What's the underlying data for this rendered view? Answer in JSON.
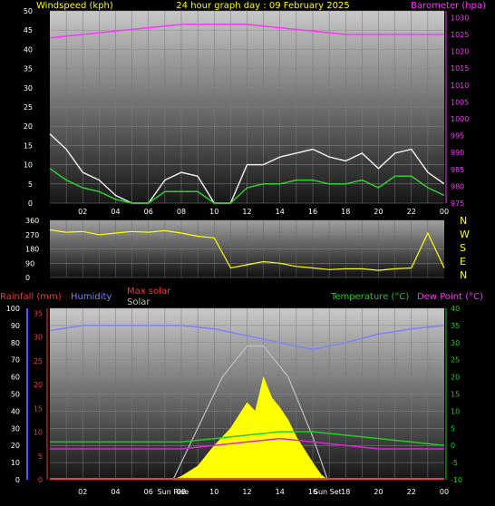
{
  "header": {
    "left_title": "Windspeed (kph)",
    "center_title": "24 hour graph day : 09 February 2025",
    "right_title": "Barometer (hpa)"
  },
  "legend": {
    "rainfall": "Rainfall (mm)",
    "humidity": "Humidity",
    "max_solar": "Max solar",
    "solar": "Solar",
    "temperature": "Temperature (°C)",
    "dewpoint": "Dew Point (°C)"
  },
  "colors": {
    "title_yellow": "#ffff00",
    "barometer": "#ff33ff",
    "wind_gust": "#e6e6e6",
    "wind_avg": "#33cc33",
    "wind_dir": "#ffff00",
    "humidity": "#8080ff",
    "temperature": "#22cc22",
    "dewpoint": "#dd22dd",
    "solar": "#ffff00",
    "max_solar": "#c0c0c0",
    "rain": "#ff3333",
    "rain_axis": "#ff3333",
    "humidity_axis": "#5555ff",
    "temp_axis": "#22cc22"
  },
  "chart_data": [
    {
      "type": "line",
      "panel": "wind_barometer",
      "x_ticks": [
        "02",
        "04",
        "06",
        "08",
        "10",
        "12",
        "14",
        "16",
        "18",
        "20",
        "22",
        "00"
      ],
      "y_left_ticks": [
        "0",
        "5",
        "10",
        "15",
        "20",
        "25",
        "30",
        "35",
        "40",
        "45",
        "50"
      ],
      "y_right_ticks": [
        "975",
        "980",
        "985",
        "990",
        "995",
        "1000",
        "1005",
        "1010",
        "1015",
        "1020",
        "1025",
        "1030"
      ],
      "ylim_left": [
        0,
        50
      ],
      "ylim_right": [
        975,
        1032
      ],
      "series": [
        {
          "role": "barometer",
          "x": [
            0,
            2,
            4,
            6,
            8,
            10,
            12,
            14,
            16,
            18,
            20,
            22,
            24
          ],
          "values": [
            1024,
            1025,
            1026,
            1027,
            1028,
            1028,
            1028,
            1027,
            1026,
            1025,
            1025,
            1025,
            1025
          ]
        },
        {
          "role": "gust",
          "x": [
            0,
            1,
            2,
            3,
            4,
            5,
            6,
            7,
            8,
            9,
            10,
            11,
            12,
            13,
            14,
            15,
            16,
            17,
            18,
            19,
            20,
            21,
            22,
            23,
            24
          ],
          "values": [
            18,
            14,
            8,
            6,
            2,
            0,
            0,
            6,
            8,
            7,
            0,
            0,
            10,
            10,
            12,
            13,
            14,
            12,
            11,
            13,
            9,
            13,
            14,
            8,
            5
          ]
        },
        {
          "role": "average",
          "x": [
            0,
            1,
            2,
            3,
            4,
            5,
            6,
            7,
            8,
            9,
            10,
            11,
            12,
            13,
            14,
            15,
            16,
            17,
            18,
            19,
            20,
            21,
            22,
            23,
            24
          ],
          "values": [
            9,
            6,
            4,
            3,
            1,
            0,
            0,
            3,
            3,
            3,
            0,
            0,
            4,
            5,
            5,
            6,
            6,
            5,
            5,
            6,
            4,
            7,
            7,
            4,
            2
          ]
        }
      ]
    },
    {
      "type": "line",
      "panel": "wind_direction",
      "direction_labels": [
        "N",
        "W",
        "S",
        "E",
        "N"
      ],
      "y_ticks": [
        "360",
        "270",
        "180",
        "90",
        "0"
      ],
      "ylim": [
        0,
        360
      ],
      "series": [
        {
          "role": "direction",
          "x": [
            0,
            1,
            2,
            3,
            4,
            5,
            6,
            7,
            8,
            9,
            10,
            11,
            12,
            13,
            14,
            15,
            16,
            17,
            18,
            19,
            20,
            21,
            22,
            23,
            24
          ],
          "values": [
            300,
            285,
            290,
            270,
            280,
            290,
            285,
            295,
            280,
            260,
            250,
            60,
            80,
            100,
            90,
            70,
            60,
            50,
            55,
            55,
            45,
            55,
            60,
            280,
            60
          ]
        }
      ]
    },
    {
      "type": "line",
      "panel": "temperature_humidity_solar",
      "x_ticks": [
        "02",
        "04",
        "06",
        "08",
        "10",
        "12",
        "14",
        "16",
        "18",
        "20",
        "22",
        "00"
      ],
      "sun_rise_label": "Sun Rise",
      "sun_set_label": "Sun Set",
      "sun_rise_hour": 7.5,
      "sun_set_hour": 16.9,
      "humidity_ticks": [
        "0",
        "10",
        "20",
        "30",
        "40",
        "50",
        "60",
        "70",
        "80",
        "90",
        "100"
      ],
      "rain_ticks": [
        "0",
        "5",
        "10",
        "15",
        "20",
        "25",
        "30",
        "35"
      ],
      "temp_ticks": [
        "-10",
        "-5",
        "0",
        "5",
        "10",
        "15",
        "20",
        "25",
        "30",
        "35",
        "40"
      ],
      "humidity_lim": [
        0,
        100
      ],
      "temp_lim": [
        -10,
        40
      ],
      "series": [
        {
          "role": "humidity",
          "x": [
            0,
            2,
            4,
            6,
            8,
            10,
            12,
            14,
            16,
            18,
            20,
            22,
            24
          ],
          "values": [
            87,
            90,
            90,
            90,
            90,
            88,
            84,
            80,
            76,
            80,
            85,
            88,
            90
          ]
        },
        {
          "role": "temperature",
          "x": [
            0,
            2,
            4,
            6,
            8,
            10,
            12,
            14,
            16,
            18,
            20,
            22,
            24
          ],
          "values": [
            1,
            1,
            1,
            1,
            1,
            2,
            3,
            4,
            4,
            3,
            2,
            1,
            0
          ]
        },
        {
          "role": "dewpoint",
          "x": [
            0,
            2,
            4,
            6,
            8,
            10,
            12,
            14,
            16,
            18,
            20,
            22,
            24
          ],
          "values": [
            -1,
            -1,
            -1,
            -1,
            -1,
            0,
            1,
            2,
            1,
            0,
            -1,
            -1,
            -1
          ]
        },
        {
          "role": "max_solar",
          "x": [
            7.5,
            9,
            10.5,
            12,
            13,
            14.5,
            16,
            16.9
          ],
          "values": [
            0,
            30,
            60,
            78,
            78,
            60,
            25,
            0
          ]
        },
        {
          "role": "solar",
          "x": [
            7.5,
            8,
            9,
            10,
            11,
            12,
            12.5,
            13,
            13.5,
            14,
            14.5,
            15,
            16,
            16.5,
            16.9
          ],
          "values": [
            0,
            2,
            8,
            20,
            30,
            45,
            40,
            60,
            48,
            42,
            35,
            25,
            10,
            3,
            0
          ]
        },
        {
          "role": "rain",
          "x": [
            0,
            24
          ],
          "values": [
            0,
            0
          ]
        }
      ]
    }
  ]
}
